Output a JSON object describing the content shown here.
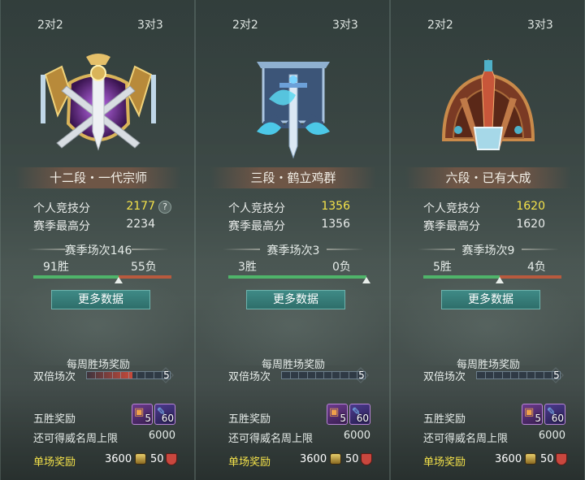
{
  "panels": [
    {
      "tabs": {
        "left": "2对2",
        "right": "3对3"
      },
      "emblem_icon": "grandmaster-sword-emblem-icon",
      "rank": "十二段・一代宗师",
      "personal_score_label": "个人竞技分",
      "personal_score": "2177",
      "season_high_label": "赛季最高分",
      "season_high": "2234",
      "season_matches": "赛季场次146",
      "wins": "91胜",
      "losses": "55负",
      "win_ratio": 0.62,
      "more_button": "更多数据",
      "weekly_title": "每周胜场奖励",
      "double_label": "双倍场次",
      "double_end_value": "5",
      "double_progress": 0.55,
      "five_win_label": "五胜奖励",
      "item1_count": "5",
      "item2_count": "60",
      "cap_label": "还可得威名周上限",
      "cap_value": "6000",
      "single_label": "单场奖励",
      "single_value1": "3600",
      "single_value2": "50"
    },
    {
      "tabs": {
        "left": "2对2",
        "right": "3对3"
      },
      "emblem_icon": "crane-banner-sword-emblem-icon",
      "rank": "三段・鹤立鸡群",
      "personal_score_label": "个人竞技分",
      "personal_score": "1356",
      "season_high_label": "赛季最高分",
      "season_high": "1356",
      "season_matches": "赛季场次3",
      "wins": "3胜",
      "losses": "0负",
      "win_ratio": 1.0,
      "more_button": "更多数据",
      "weekly_title": "每周胜场奖励",
      "double_label": "双倍场次",
      "double_end_value": "5",
      "double_progress": 0.0,
      "five_win_label": "五胜奖励",
      "item1_count": "5",
      "item2_count": "60",
      "cap_label": "还可得威名周上限",
      "cap_value": "6000",
      "single_label": "单场奖励",
      "single_value1": "3600",
      "single_value2": "50"
    },
    {
      "tabs": {
        "left": "2对2",
        "right": "3对3"
      },
      "emblem_icon": "bronze-sword-emblem-icon",
      "rank": "六段・已有大成",
      "personal_score_label": "个人竞技分",
      "personal_score": "1620",
      "season_high_label": "赛季最高分",
      "season_high": "1620",
      "season_matches": "赛季场次9",
      "wins": "5胜",
      "losses": "4负",
      "win_ratio": 0.55,
      "more_button": "更多数据",
      "weekly_title": "每周胜场奖励",
      "double_label": "双倍场次",
      "double_end_value": "5",
      "double_progress": 0.0,
      "five_win_label": "五胜奖励",
      "item1_count": "5",
      "item2_count": "60",
      "cap_label": "还可得威名周上限",
      "cap_value": "6000",
      "single_label": "单场奖励",
      "single_value1": "3600",
      "single_value2": "50"
    }
  ],
  "help_glyph": "?"
}
